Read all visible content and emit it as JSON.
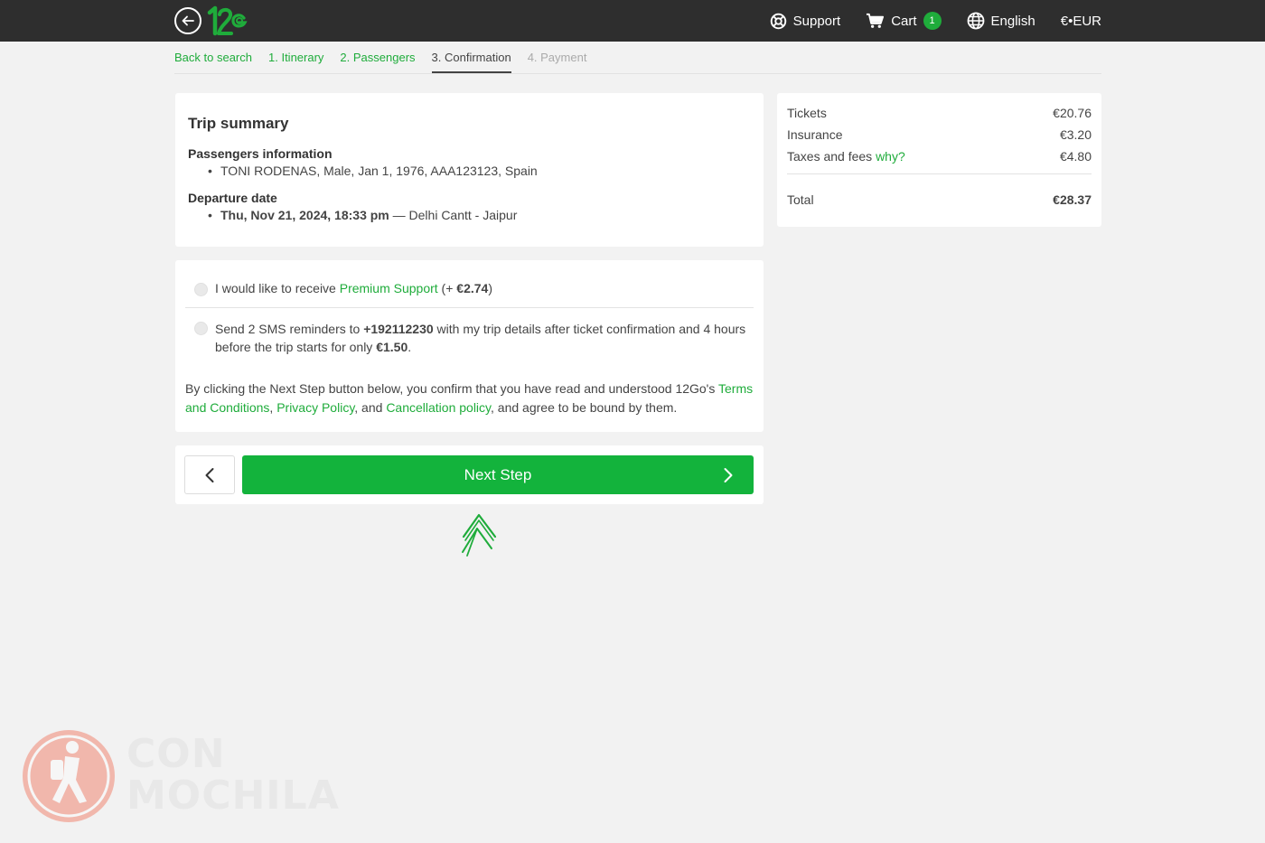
{
  "header": {
    "brand": "12Go",
    "support_label": "Support",
    "cart_label": "Cart",
    "cart_count": "1",
    "language_label": "English",
    "currency_label": "€•EUR"
  },
  "breadcrumb": {
    "back": "Back to search",
    "step1": "1. Itinerary",
    "step2": "2. Passengers",
    "step3": "3. Confirmation",
    "step4": "4. Payment"
  },
  "trip": {
    "title": "Trip summary",
    "passengers_heading": "Passengers information",
    "passenger": "TONI RODENAS, Male, Jan 1, 1976, AAA123123, Spain",
    "departure_heading": "Departure date",
    "departure_datetime": "Thu, Nov 21, 2024, 18:33 pm",
    "departure_separator": " — ",
    "departure_route": "Delhi Cantt - Jaipur"
  },
  "options": {
    "premium_prefix": "I would like to receive ",
    "premium_link": "Premium Support",
    "premium_open": " (+ ",
    "premium_price": "€2.74",
    "premium_close": ")",
    "sms_prefix": "Send 2 SMS reminders to ",
    "sms_phone": "+192112230",
    "sms_middle": " with my trip details after ticket confirmation and 4 hours before the trip starts for only ",
    "sms_price": "€1.50",
    "sms_suffix": "."
  },
  "consent": {
    "text_before": "By clicking the Next Step button below, you confirm that you have read and understood 12Go's ",
    "terms": "Terms and Conditions",
    "comma": ", ",
    "privacy": "Privacy Policy",
    "and": ", and ",
    "cancellation": "Cancellation policy",
    "text_after": ", and agree to be bound by them."
  },
  "actions": {
    "next_label": "Next Step"
  },
  "pricing": {
    "tickets_label": "Tickets",
    "tickets_value": "€20.76",
    "insurance_label": "Insurance",
    "insurance_value": "€3.20",
    "taxes_label": "Taxes and fees ",
    "taxes_link": "why?",
    "taxes_value": "€4.80",
    "total_label": "Total",
    "total_value": "€28.37"
  },
  "watermark": {
    "line1": "CON",
    "line2": "MOCHILA"
  },
  "colors": {
    "brand_green": "#13b33c",
    "header_bg": "#2e2e2e",
    "page_bg": "#f2f2f2"
  }
}
